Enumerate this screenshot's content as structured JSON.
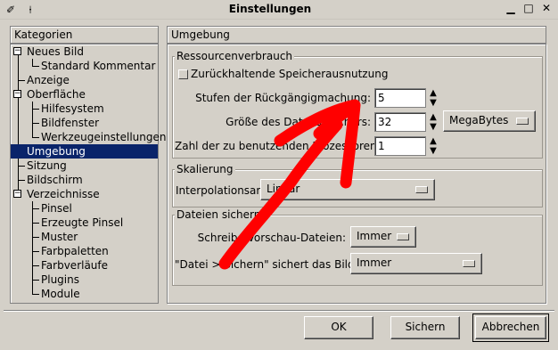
{
  "window": {
    "title": "Einstellungen",
    "icons": {
      "app": "brush-icon",
      "pin": "pin-icon",
      "minimize": "minimize-icon",
      "maximize": "maximize-icon",
      "close": "close-icon"
    },
    "glyphs": {
      "app": "✐",
      "pin": "⍿",
      "minimize": "▁",
      "maximize": "□",
      "close": "✕"
    }
  },
  "sidebar": {
    "header": "Kategorien",
    "items": [
      {
        "label": "Neues Bild"
      },
      {
        "label": "Standard Kommentar"
      },
      {
        "label": "Anzeige"
      },
      {
        "label": "Oberfläche"
      },
      {
        "label": "Hilfesystem"
      },
      {
        "label": "Bildfenster"
      },
      {
        "label": "Werkzeugeinstellungen"
      },
      {
        "label": "Umgebung"
      },
      {
        "label": "Sitzung"
      },
      {
        "label": "Bildschirm"
      },
      {
        "label": "Verzeichnisse"
      },
      {
        "label": "Pinsel"
      },
      {
        "label": "Erzeugte Pinsel"
      },
      {
        "label": "Muster"
      },
      {
        "label": "Farbpaletten"
      },
      {
        "label": "Farbverläufe"
      },
      {
        "label": "Plugins"
      },
      {
        "label": "Module"
      }
    ],
    "selected": "Umgebung"
  },
  "main": {
    "header": "Umgebung",
    "resources": {
      "title": "Ressourcenverbrauch",
      "conservative_label": "Zurückhaltende Speicherausnutzung",
      "undo_label": "Stufen der Rückgängigmachung:",
      "undo_value": "5",
      "cache_label": "Größe des Datenspeichers:",
      "cache_value": "32",
      "cache_unit": "MegaBytes",
      "processors_label": "Zahl der zu benutzenden Prozessoren:",
      "processors_value": "1"
    },
    "scaling": {
      "title": "Skalierung",
      "interp_label": "Interpolationsart:",
      "interp_value": "Linear"
    },
    "saving": {
      "title": "Dateien sichern",
      "preview_label": "Schreibe Vorschau-Dateien:",
      "preview_value": "Immer",
      "save_label": "\"Datei > Sichern\" sichert das Bild:",
      "save_value": "Immer"
    }
  },
  "footer": {
    "ok": "OK",
    "save": "Sichern",
    "cancel": "Abbrechen"
  },
  "annotation": {
    "color": "#ff0000"
  }
}
